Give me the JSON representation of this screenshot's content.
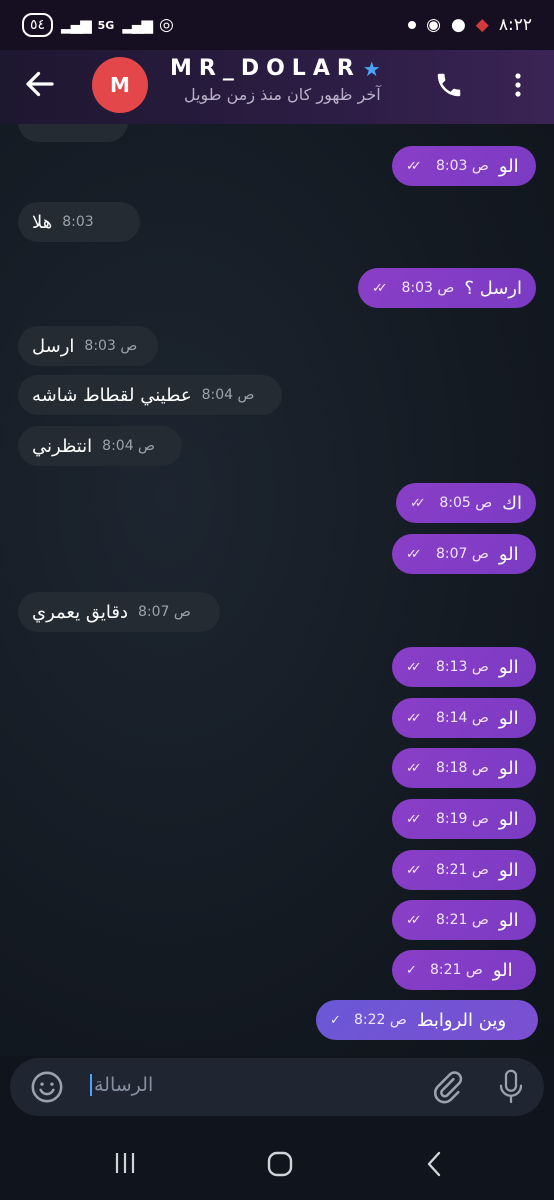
{
  "status_bar": {
    "battery": "٥٤",
    "network": "5G",
    "time": "٨:٢٢"
  },
  "header": {
    "avatar_letter": "M",
    "name": "MR_DOLAR",
    "last_seen": "آخر ظهور كان منذ زمن طويل",
    "icons": [
      "back-arrow-icon",
      "phone-icon",
      "more-vertical-icon",
      "verified-star-icon"
    ]
  },
  "messages": [
    {
      "dir": "out",
      "text": "الو",
      "time": "8:03 ص",
      "status": "read"
    },
    {
      "dir": "in",
      "text": "هلا",
      "time": "8:03"
    },
    {
      "dir": "out",
      "text": "ارسل ؟",
      "time": "8:03 ص",
      "status": "read"
    },
    {
      "dir": "in",
      "text": "ارسل",
      "time": "8:03 ص"
    },
    {
      "dir": "in",
      "text": "عطيني لقطاط شاشه",
      "time": "8:04 ص"
    },
    {
      "dir": "in",
      "text": "انتظرني",
      "time": "8:04 ص"
    },
    {
      "dir": "out",
      "text": "اك",
      "time": "8:05 ص",
      "status": "read"
    },
    {
      "dir": "out",
      "text": "الو",
      "time": "8:07 ص",
      "status": "read"
    },
    {
      "dir": "in",
      "text": "دقايق يعمري",
      "time": "8:07 ص"
    },
    {
      "dir": "out",
      "text": "الو",
      "time": "8:13 ص",
      "status": "read"
    },
    {
      "dir": "out",
      "text": "الو",
      "time": "8:14 ص",
      "status": "read"
    },
    {
      "dir": "out",
      "text": "الو",
      "time": "8:18 ص",
      "status": "read"
    },
    {
      "dir": "out",
      "text": "الو",
      "time": "8:19 ص",
      "status": "read"
    },
    {
      "dir": "out",
      "text": "الو",
      "time": "8:21 ص",
      "status": "read"
    },
    {
      "dir": "out",
      "text": "الو",
      "time": "8:21 ص",
      "status": "read"
    },
    {
      "dir": "out",
      "text": "الو",
      "time": "8:21 ص",
      "status": "sent"
    },
    {
      "dir": "out",
      "text": "وين الروابط",
      "time": "8:22 ص",
      "status": "sent"
    }
  ],
  "input": {
    "placeholder": "الرسالة",
    "icons": [
      "emoji-icon",
      "attach-icon",
      "mic-icon"
    ]
  },
  "nav": {
    "icons": [
      "recent-apps-icon",
      "home-icon",
      "back-icon"
    ]
  },
  "colors": {
    "outgoing_bubble": "#8b3ec8",
    "incoming_bubble": "#252b33",
    "avatar": "#e4474a",
    "accent": "#4aa3ff"
  }
}
